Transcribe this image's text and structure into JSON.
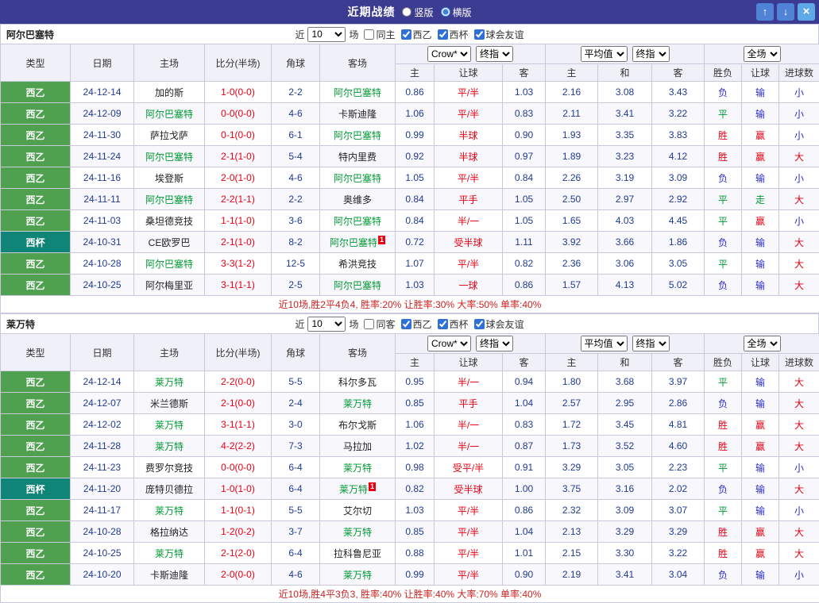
{
  "topbar": {
    "title": "近期战绩",
    "view_options": [
      {
        "label": "竖版",
        "selected": false
      },
      {
        "label": "横版",
        "selected": true
      }
    ],
    "buttons": {
      "up": "↑",
      "down": "↓",
      "close": "×"
    }
  },
  "colors": {
    "topbar_bg": "#3c3b92",
    "win": "#e60012",
    "draw": "#009933",
    "lose": "#2b2bd0",
    "navy": "#203a94",
    "team_focus": "#009933",
    "summary_red": "#cc2222"
  },
  "league_colors": {
    "西乙": "#4fa14f",
    "西杯": "#0e8576"
  },
  "table_headers": {
    "col_type": "类型",
    "col_date": "日期",
    "col_home": "主场",
    "col_score": "比分(半场)",
    "col_corner": "角球",
    "col_away": "客场",
    "col_home_odds": "主",
    "col_handicap": "让球",
    "col_away_odds": "客",
    "col_avg_home": "主",
    "col_avg_draw": "和",
    "col_avg_away": "客",
    "col_result": "胜负",
    "col_handicap_result": "让球",
    "col_goals": "进球数"
  },
  "sections": [
    {
      "team": "阿尔巴塞特",
      "filter": {
        "prefix": "近",
        "count": "10",
        "suffix": "场",
        "checkboxes": [
          {
            "label": "同主",
            "checked": false
          },
          {
            "label": "西乙",
            "checked": true
          },
          {
            "label": "西杯",
            "checked": true
          },
          {
            "label": "球会友谊",
            "checked": true
          }
        ]
      },
      "dropdowns": {
        "company": "Crow*",
        "company_mode": "终指",
        "avg": "平均值",
        "avg_mode": "终指",
        "scope": "全场"
      },
      "rows": [
        {
          "league": "西乙",
          "date": "24-12-14",
          "home": "加的斯",
          "home_focus": false,
          "home_card": "",
          "score": "1-0(0-0)",
          "corners": "2-2",
          "away": "阿尔巴塞特",
          "away_focus": true,
          "away_card": "",
          "odds_home": "0.86",
          "handicap": "平/半",
          "odds_away": "1.03",
          "avg_home": "2.16",
          "avg_draw": "3.08",
          "avg_away": "3.43",
          "result": "负",
          "handicap_result": "输",
          "goals": "小"
        },
        {
          "league": "西乙",
          "date": "24-12-09",
          "home": "阿尔巴塞特",
          "home_focus": true,
          "home_card": "",
          "score": "0-0(0-0)",
          "corners": "4-6",
          "away": "卡斯迪隆",
          "away_focus": false,
          "away_card": "",
          "odds_home": "1.06",
          "handicap": "平/半",
          "odds_away": "0.83",
          "avg_home": "2.11",
          "avg_draw": "3.41",
          "avg_away": "3.22",
          "result": "平",
          "handicap_result": "输",
          "goals": "小"
        },
        {
          "league": "西乙",
          "date": "24-11-30",
          "home": "萨拉戈萨",
          "home_focus": false,
          "home_card": "",
          "score": "0-1(0-0)",
          "corners": "6-1",
          "away": "阿尔巴塞特",
          "away_focus": true,
          "away_card": "",
          "odds_home": "0.99",
          "handicap": "半球",
          "odds_away": "0.90",
          "avg_home": "1.93",
          "avg_draw": "3.35",
          "avg_away": "3.83",
          "result": "胜",
          "handicap_result": "赢",
          "goals": "小"
        },
        {
          "league": "西乙",
          "date": "24-11-24",
          "home": "阿尔巴塞特",
          "home_focus": true,
          "home_card": "",
          "score": "2-1(1-0)",
          "corners": "5-4",
          "away": "特内里费",
          "away_focus": false,
          "away_card": "",
          "odds_home": "0.92",
          "handicap": "半球",
          "odds_away": "0.97",
          "avg_home": "1.89",
          "avg_draw": "3.23",
          "avg_away": "4.12",
          "result": "胜",
          "handicap_result": "赢",
          "goals": "大"
        },
        {
          "league": "西乙",
          "date": "24-11-16",
          "home": "埃登斯",
          "home_focus": false,
          "home_card": "",
          "score": "2-0(1-0)",
          "corners": "4-6",
          "away": "阿尔巴塞特",
          "away_focus": true,
          "away_card": "",
          "odds_home": "1.05",
          "handicap": "平/半",
          "odds_away": "0.84",
          "avg_home": "2.26",
          "avg_draw": "3.19",
          "avg_away": "3.09",
          "result": "负",
          "handicap_result": "输",
          "goals": "小"
        },
        {
          "league": "西乙",
          "date": "24-11-11",
          "home": "阿尔巴塞特",
          "home_focus": true,
          "home_card": "",
          "score": "2-2(1-1)",
          "corners": "2-2",
          "away": "奥维多",
          "away_focus": false,
          "away_card": "",
          "odds_home": "0.84",
          "handicap": "平手",
          "odds_away": "1.05",
          "avg_home": "2.50",
          "avg_draw": "2.97",
          "avg_away": "2.92",
          "result": "平",
          "handicap_result": "走",
          "goals": "大"
        },
        {
          "league": "西乙",
          "date": "24-11-03",
          "home": "桑坦德竞技",
          "home_focus": false,
          "home_card": "",
          "score": "1-1(1-0)",
          "corners": "3-6",
          "away": "阿尔巴塞特",
          "away_focus": true,
          "away_card": "",
          "odds_home": "0.84",
          "handicap": "半/一",
          "odds_away": "1.05",
          "avg_home": "1.65",
          "avg_draw": "4.03",
          "avg_away": "4.45",
          "result": "平",
          "handicap_result": "赢",
          "goals": "小"
        },
        {
          "league": "西杯",
          "date": "24-10-31",
          "home": "CE欧罗巴",
          "home_focus": false,
          "home_card": "",
          "score": "2-1(1-0)",
          "corners": "8-2",
          "away": "阿尔巴塞特",
          "away_focus": true,
          "away_card": "1",
          "odds_home": "0.72",
          "handicap": "受半球",
          "odds_away": "1.11",
          "avg_home": "3.92",
          "avg_draw": "3.66",
          "avg_away": "1.86",
          "result": "负",
          "handicap_result": "输",
          "goals": "大"
        },
        {
          "league": "西乙",
          "date": "24-10-28",
          "home": "阿尔巴塞特",
          "home_focus": true,
          "home_card": "",
          "score": "3-3(1-2)",
          "corners": "12-5",
          "away": "希洪竞技",
          "away_focus": false,
          "away_card": "",
          "odds_home": "1.07",
          "handicap": "平/半",
          "odds_away": "0.82",
          "avg_home": "2.36",
          "avg_draw": "3.06",
          "avg_away": "3.05",
          "result": "平",
          "handicap_result": "输",
          "goals": "大"
        },
        {
          "league": "西乙",
          "date": "24-10-25",
          "home": "阿尔梅里亚",
          "home_focus": false,
          "home_card": "",
          "score": "3-1(1-1)",
          "corners": "2-5",
          "away": "阿尔巴塞特",
          "away_focus": true,
          "away_card": "",
          "odds_home": "1.03",
          "handicap": "一球",
          "odds_away": "0.86",
          "avg_home": "1.57",
          "avg_draw": "4.13",
          "avg_away": "5.02",
          "result": "负",
          "handicap_result": "输",
          "goals": "大"
        }
      ],
      "summary": "近10场,胜2平4负4, 胜率:20% 让胜率:30% 大率:50% 单率:40%"
    },
    {
      "team": "莱万特",
      "filter": {
        "prefix": "近",
        "count": "10",
        "suffix": "场",
        "checkboxes": [
          {
            "label": "同客",
            "checked": false
          },
          {
            "label": "西乙",
            "checked": true
          },
          {
            "label": "西杯",
            "checked": true
          },
          {
            "label": "球会友谊",
            "checked": true
          }
        ]
      },
      "dropdowns": {
        "company": "Crow*",
        "company_mode": "终指",
        "avg": "平均值",
        "avg_mode": "终指",
        "scope": "全场"
      },
      "rows": [
        {
          "league": "西乙",
          "date": "24-12-14",
          "home": "莱万特",
          "home_focus": true,
          "home_card": "",
          "score": "2-2(0-0)",
          "corners": "5-5",
          "away": "科尔多瓦",
          "away_focus": false,
          "away_card": "",
          "odds_home": "0.95",
          "handicap": "半/一",
          "odds_away": "0.94",
          "avg_home": "1.80",
          "avg_draw": "3.68",
          "avg_away": "3.97",
          "result": "平",
          "handicap_result": "输",
          "goals": "大"
        },
        {
          "league": "西乙",
          "date": "24-12-07",
          "home": "米兰德斯",
          "home_focus": false,
          "home_card": "",
          "score": "2-1(0-0)",
          "corners": "2-4",
          "away": "莱万特",
          "away_focus": true,
          "away_card": "",
          "odds_home": "0.85",
          "handicap": "平手",
          "odds_away": "1.04",
          "avg_home": "2.57",
          "avg_draw": "2.95",
          "avg_away": "2.86",
          "result": "负",
          "handicap_result": "输",
          "goals": "大"
        },
        {
          "league": "西乙",
          "date": "24-12-02",
          "home": "莱万特",
          "home_focus": true,
          "home_card": "",
          "score": "3-1(1-1)",
          "corners": "3-0",
          "away": "布尔戈斯",
          "away_focus": false,
          "away_card": "",
          "odds_home": "1.06",
          "handicap": "半/一",
          "odds_away": "0.83",
          "avg_home": "1.72",
          "avg_draw": "3.45",
          "avg_away": "4.81",
          "result": "胜",
          "handicap_result": "赢",
          "goals": "大"
        },
        {
          "league": "西乙",
          "date": "24-11-28",
          "home": "莱万特",
          "home_focus": true,
          "home_card": "",
          "score": "4-2(2-2)",
          "corners": "7-3",
          "away": "马拉加",
          "away_focus": false,
          "away_card": "",
          "odds_home": "1.02",
          "handicap": "半/一",
          "odds_away": "0.87",
          "avg_home": "1.73",
          "avg_draw": "3.52",
          "avg_away": "4.60",
          "result": "胜",
          "handicap_result": "赢",
          "goals": "大"
        },
        {
          "league": "西乙",
          "date": "24-11-23",
          "home": "费罗尔竞技",
          "home_focus": false,
          "home_card": "",
          "score": "0-0(0-0)",
          "corners": "6-4",
          "away": "莱万特",
          "away_focus": true,
          "away_card": "",
          "odds_home": "0.98",
          "handicap": "受平/半",
          "odds_away": "0.91",
          "avg_home": "3.29",
          "avg_draw": "3.05",
          "avg_away": "2.23",
          "result": "平",
          "handicap_result": "输",
          "goals": "小"
        },
        {
          "league": "西杯",
          "date": "24-11-20",
          "home": "庞特贝德拉",
          "home_focus": false,
          "home_card": "",
          "score": "1-0(1-0)",
          "corners": "6-4",
          "away": "莱万特",
          "away_focus": true,
          "away_card": "1",
          "odds_home": "0.82",
          "handicap": "受半球",
          "odds_away": "1.00",
          "avg_home": "3.75",
          "avg_draw": "3.16",
          "avg_away": "2.02",
          "result": "负",
          "handicap_result": "输",
          "goals": "大"
        },
        {
          "league": "西乙",
          "date": "24-11-17",
          "home": "莱万特",
          "home_focus": true,
          "home_card": "",
          "score": "1-1(0-1)",
          "corners": "5-5",
          "away": "艾尔切",
          "away_focus": false,
          "away_card": "",
          "odds_home": "1.03",
          "handicap": "平/半",
          "odds_away": "0.86",
          "avg_home": "2.32",
          "avg_draw": "3.09",
          "avg_away": "3.07",
          "result": "平",
          "handicap_result": "输",
          "goals": "小"
        },
        {
          "league": "西乙",
          "date": "24-10-28",
          "home": "格拉纳达",
          "home_focus": false,
          "home_card": "",
          "score": "1-2(0-2)",
          "corners": "3-7",
          "away": "莱万特",
          "away_focus": true,
          "away_card": "",
          "odds_home": "0.85",
          "handicap": "平/半",
          "odds_away": "1.04",
          "avg_home": "2.13",
          "avg_draw": "3.29",
          "avg_away": "3.29",
          "result": "胜",
          "handicap_result": "赢",
          "goals": "大"
        },
        {
          "league": "西乙",
          "date": "24-10-25",
          "home": "莱万特",
          "home_focus": true,
          "home_card": "",
          "score": "2-1(2-0)",
          "corners": "6-4",
          "away": "拉科鲁尼亚",
          "away_focus": false,
          "away_card": "",
          "odds_home": "0.88",
          "handicap": "平/半",
          "odds_away": "1.01",
          "avg_home": "2.15",
          "avg_draw": "3.30",
          "avg_away": "3.22",
          "result": "胜",
          "handicap_result": "赢",
          "goals": "大"
        },
        {
          "league": "西乙",
          "date": "24-10-20",
          "home": "卡斯迪隆",
          "home_focus": false,
          "home_card": "",
          "score": "2-0(0-0)",
          "corners": "4-6",
          "away": "莱万特",
          "away_focus": true,
          "away_card": "",
          "odds_home": "0.99",
          "handicap": "平/半",
          "odds_away": "0.90",
          "avg_home": "2.19",
          "avg_draw": "3.41",
          "avg_away": "3.04",
          "result": "负",
          "handicap_result": "输",
          "goals": "小"
        }
      ],
      "summary": "近10场,胜4平3负3, 胜率:40% 让胜率:40% 大率:70% 单率:40%"
    }
  ]
}
